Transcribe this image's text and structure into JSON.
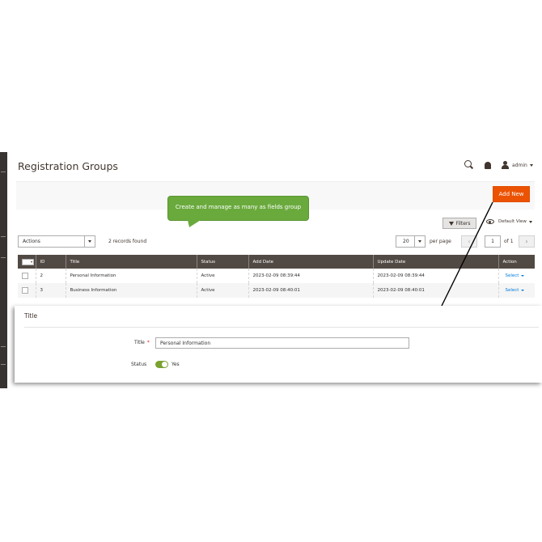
{
  "header": {
    "page_title": "Registration Groups",
    "user_name": "admin"
  },
  "toolbar": {
    "add_new_label": "Add New",
    "callout_text": "Create and manage as many as fields group",
    "filters_label": "Filters",
    "view_label": "Default View"
  },
  "grid_controls": {
    "actions_label": "Actions",
    "records_found": "2 records found",
    "per_page_value": "20",
    "per_page_label": "per page",
    "current_page": "1",
    "total_pages": "of 1"
  },
  "grid": {
    "columns": [
      "ID",
      "Title",
      "Status",
      "Add Date",
      "Update Date",
      "Action"
    ],
    "rows": [
      {
        "id": "2",
        "title": "Personal Information",
        "status": "Active",
        "add_date": "2023-02-09 08:39:44",
        "update_date": "2023-02-09 08:39:44",
        "action": "Select"
      },
      {
        "id": "3",
        "title": "Business Information",
        "status": "Active",
        "add_date": "2023-02-09 08:40:01",
        "update_date": "2023-02-09 08:40:01",
        "action": "Select"
      }
    ]
  },
  "form": {
    "section_title": "Title",
    "title_label": "Title",
    "required_mark": "*",
    "title_value": "Personal Information",
    "status_label": "Status",
    "status_value": "Yes",
    "status_enabled": true
  },
  "colors": {
    "accent": "#eb5202",
    "callout": "#6aaa3d",
    "grid_header": "#514943",
    "link": "#007bdb",
    "toggle_on": "#79a22e"
  }
}
